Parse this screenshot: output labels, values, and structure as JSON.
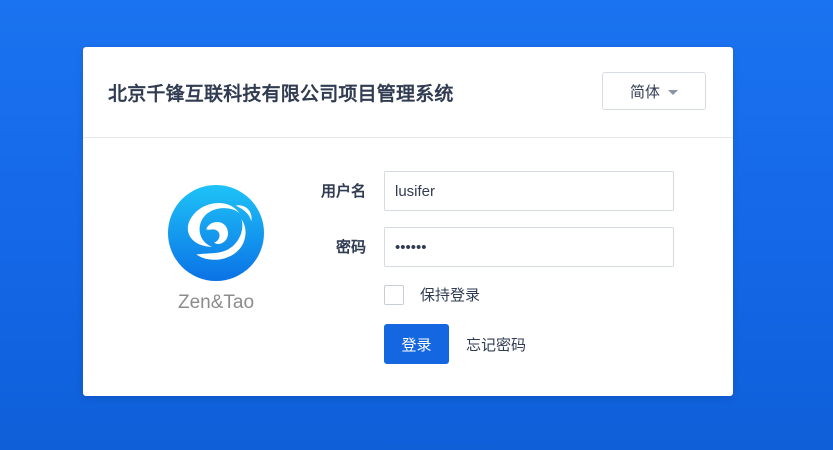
{
  "header": {
    "title": "北京千锋互联科技有限公司项目管理系统",
    "language_label": "简体"
  },
  "logo": {
    "text": "Zen&Tao",
    "icon": "zentao-swirl-logo",
    "colors": [
      "#1ec3f7",
      "#0b72e6"
    ]
  },
  "form": {
    "username_label": "用户名",
    "username_value": "lusifer",
    "password_label": "密码",
    "password_value": "••••••",
    "keep_login_label": "保持登录",
    "keep_login_checked": false,
    "login_button": "登录",
    "forgot_password": "忘记密码"
  },
  "colors": {
    "background": "#1a6fee",
    "primary": "#1467e0",
    "text": "#313c52"
  }
}
